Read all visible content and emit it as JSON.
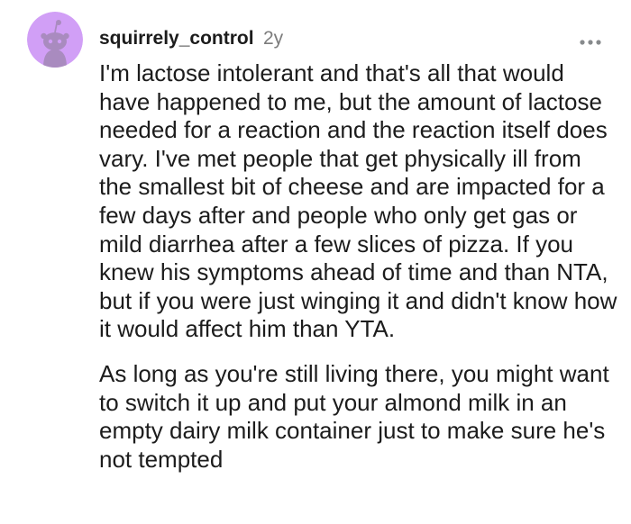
{
  "comment": {
    "author": "squirrely_control",
    "age": "2y",
    "avatar_icon": "snoo-avatar-icon",
    "avatar_color": "#d19ff6",
    "more_icon": "more-options-icon",
    "paragraphs": [
      "I'm lactose intolerant and that's all that would have happened to me, but the amount of lactose needed for a reaction and the reaction itself does vary. I've met people that get physically ill from the smallest bit of cheese and are impacted for a few days after and people who only get gas or mild diarrhea after a few slices of pizza. If you knew his symptoms ahead of time and than NTA, but if you were just winging it and didn't know how it would affect him than YTA.",
      "As long as you're still living there, you might want to switch it up and put your almond milk in an empty dairy milk container just to make sure he's not tempted"
    ]
  }
}
